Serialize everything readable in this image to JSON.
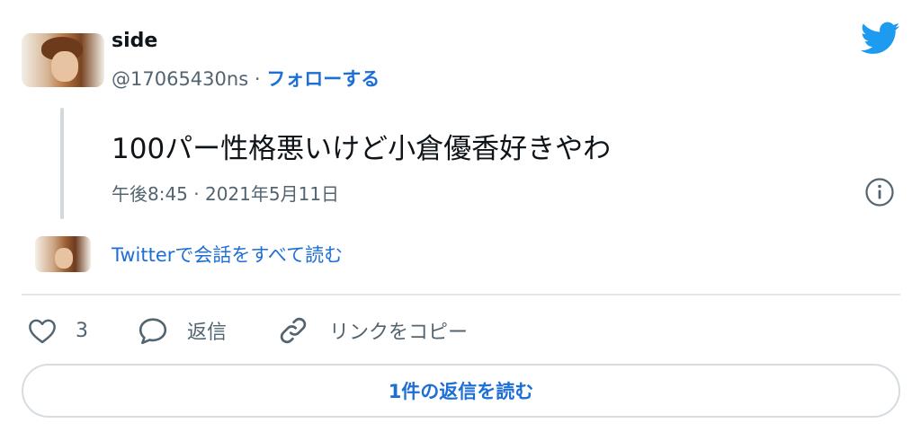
{
  "author": {
    "display_name": "side",
    "handle": "@17065430ns",
    "separator": "·",
    "follow_label": "フォローする"
  },
  "tweet": {
    "text": "100パー性格悪いけど小倉優香好きやわ",
    "timestamp": "午後8:45 · 2021年5月11日"
  },
  "thread": {
    "read_conversation_label": "Twitterで会話をすべて読む"
  },
  "actions": {
    "like_count": "3",
    "reply_label": "返信",
    "copy_link_label": "リンクをコピー"
  },
  "footer": {
    "read_replies_label": "1件の返信を読む"
  },
  "icons": {
    "logo": "twitter-bird-icon",
    "info": "info-icon",
    "like": "heart-icon",
    "reply": "speech-bubble-icon",
    "link": "link-icon"
  },
  "colors": {
    "link_blue": "#1d6fd6",
    "twitter_blue": "#1d9bf0",
    "secondary_text": "#536471",
    "thread_line": "#cfd9de"
  }
}
